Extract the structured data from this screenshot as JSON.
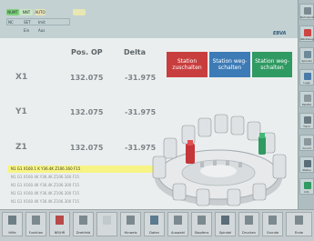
{
  "status_pills": {
    "pill1": "NUMT",
    "pill2": "NNT",
    "pill3": "AUTO"
  },
  "status_row": {
    "a": "NC",
    "b": "SET",
    "c": "Imit",
    "d": "Ein",
    "e": "Aus"
  },
  "brand": "EBVA",
  "position_header": "Pos. OP",
  "delta_header": "Delta",
  "axes": [
    {
      "label": "X1",
      "pos": "132.075",
      "delta": "-31.975"
    },
    {
      "label": "Y1",
      "pos": "132.075",
      "delta": "-31.975"
    },
    {
      "label": "Z1",
      "pos": "132.075",
      "delta": "-31.975"
    }
  ],
  "station_buttons": {
    "on_label": "Station zuschalten",
    "off_label": "Station weg-schalten",
    "off_label2": "Station weg-schalten"
  },
  "nc_lines": [
    "N1 G1 X160.1 K Y36.4K Z106.160 F15",
    "N1 G1 X160.4K Y36.4K Z106.160 F15",
    "N1 G1 X160.4K Y36.4K Z106.300 F15",
    "N1 G1 X160.4K Y36.4K Z106.300 F15",
    "N1 G1 X160.4K Y36.4K Z106.300 F15"
  ],
  "right_tools": [
    "Bahnkontrolle",
    "Werkzeug",
    "Spindel",
    "Lage",
    "Palette",
    "Tisch",
    "Grund",
    "Status",
    "Info"
  ],
  "bottom_buttons": [
    "Hilfe",
    "Funktion",
    "NR/HR",
    "Drehfeld",
    "",
    "Hinweis",
    "Daten",
    "Auswahl",
    "Stopfens",
    "Spindel",
    "Drucken",
    "Grunde",
    "Ende"
  ],
  "colors": {
    "station_on": "#c83e3e",
    "station_off_blue": "#3d7bb6",
    "station_off_green": "#2f9a62",
    "highlight_line": "#f7f486"
  }
}
